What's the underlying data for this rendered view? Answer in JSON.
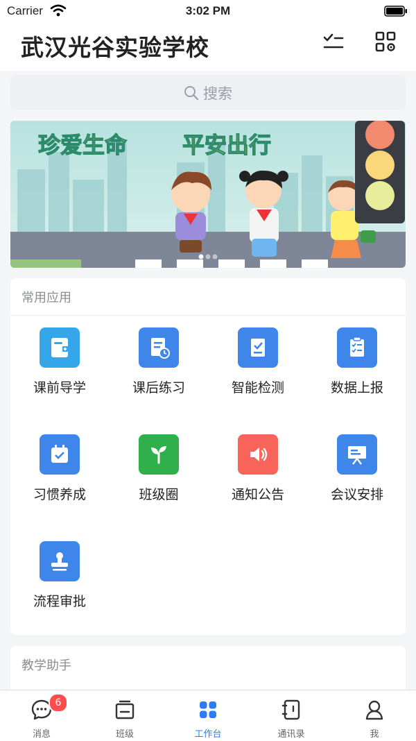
{
  "status_bar": {
    "carrier": "Carrier",
    "time": "3:02 PM"
  },
  "header": {
    "title": "武汉光谷实验学校"
  },
  "search": {
    "placeholder": "搜索"
  },
  "banner": {
    "slogan_1": "珍爱生命",
    "slogan_2": "平安出行",
    "page_count": 3,
    "active_page": 1
  },
  "common_apps": {
    "title": "常用应用",
    "items": [
      {
        "label": "课前导学",
        "icon": "tablet-icon",
        "color": "#35a6ea"
      },
      {
        "label": "课后练习",
        "icon": "document-clock-icon",
        "color": "#3f86ea"
      },
      {
        "label": "智能检测",
        "icon": "clipboard-check-icon",
        "color": "#3f86ea"
      },
      {
        "label": "数据上报",
        "icon": "checklist-icon",
        "color": "#3f86ea"
      },
      {
        "label": "习惯养成",
        "icon": "calendar-check-icon",
        "color": "#3f86ea"
      },
      {
        "label": "班级圈",
        "icon": "sprout-icon",
        "color": "#2fb04b"
      },
      {
        "label": "通知公告",
        "icon": "speaker-icon",
        "color": "#f7645a"
      },
      {
        "label": "会议安排",
        "icon": "presentation-board-icon",
        "color": "#3f86ea"
      },
      {
        "label": "流程审批",
        "icon": "stamp-icon",
        "color": "#3f86ea"
      }
    ]
  },
  "teaching_assistant": {
    "title": "教学助手"
  },
  "tab_bar": {
    "items": [
      {
        "label": "消息",
        "icon": "message-icon",
        "badge": "6"
      },
      {
        "label": "班级",
        "icon": "class-icon"
      },
      {
        "label": "工作台",
        "icon": "workbench-icon",
        "active": true
      },
      {
        "label": "通讯录",
        "icon": "contacts-icon"
      },
      {
        "label": "我",
        "icon": "profile-icon"
      }
    ],
    "active_color": "#2d7cf6"
  }
}
